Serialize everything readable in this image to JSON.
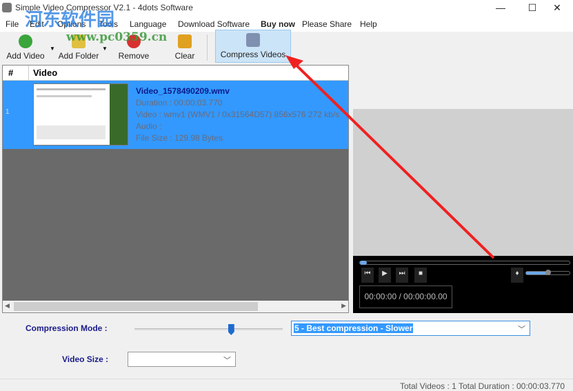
{
  "window": {
    "title": "Simple Video Compressor V2.1 - 4dots Software",
    "minimize": "—",
    "maximize": "☐",
    "close": "✕"
  },
  "watermark": {
    "site_name": "河东软件园",
    "url": "www.pc0359.cn"
  },
  "menu": [
    "File",
    "Edit",
    "Options",
    "Tools",
    "Language",
    "Download Software",
    "Buy now",
    "Please Share",
    "Help"
  ],
  "toolbar": {
    "add_video": "Add Video",
    "add_folder": "Add Folder",
    "remove": "Remove",
    "clear": "Clear",
    "compress": "Compress Videos"
  },
  "list": {
    "columns": [
      "#",
      "Video"
    ],
    "rows": [
      {
        "index": "1",
        "name": "Video_1578490209.wmv",
        "duration": "Duration : 00:00:03.770",
        "video": "Video : wmv1 (WMV1 / 0x31564D57) 856x576 272 kb/s",
        "audio": "Audio :",
        "size": "File Size : 129.98 Bytes"
      }
    ]
  },
  "player": {
    "time": "00:00:00 / 00:00:00.00",
    "position": 0.0,
    "volume": 0.5
  },
  "compression": {
    "label": "Compression Mode :",
    "value": "5 - Best compression - Slower",
    "slider_level": 0.65
  },
  "video_size": {
    "label": "Video Size :",
    "value": ""
  },
  "status": "Total Videos : 1  Total Duration : 00:00:03.770"
}
